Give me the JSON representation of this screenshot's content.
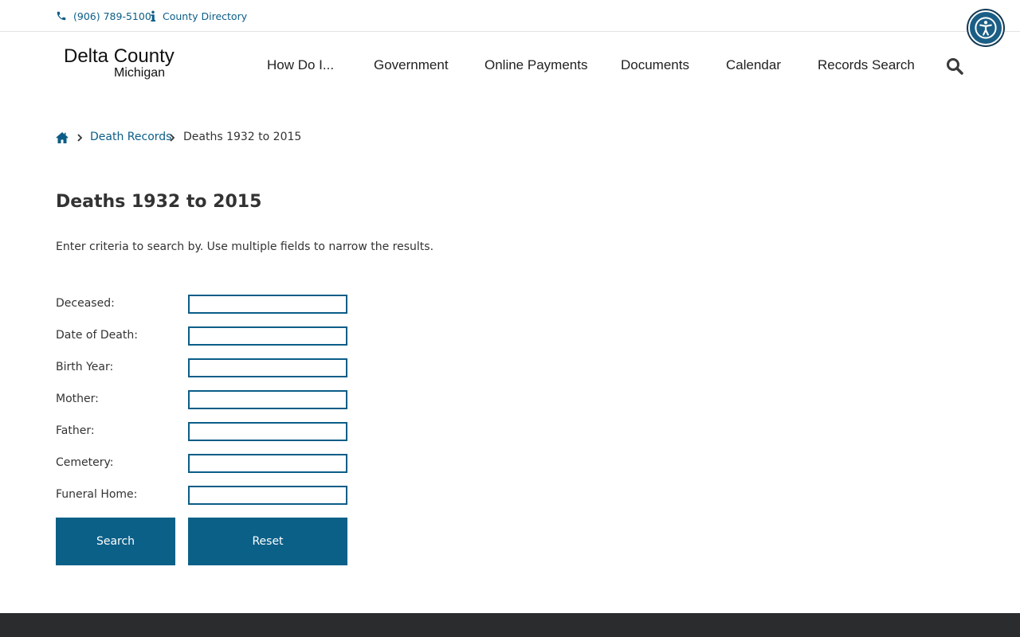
{
  "utility": {
    "phone_icon": "phone-icon",
    "phone": "(906) 789-5100",
    "info_icon": "info-icon",
    "directory": "County Directory"
  },
  "accessibility": {
    "icon": "accessibility-icon"
  },
  "logo": {
    "line1": "Delta County",
    "line2": "Michigan"
  },
  "nav": {
    "items": [
      "How Do I...",
      "Government",
      "Online Payments",
      "Documents",
      "Calendar",
      "Records Search"
    ],
    "search_icon": "search-icon"
  },
  "breadcrumb": {
    "home_icon": "home-icon",
    "items": [
      "Death Records",
      "Deaths 1932 to 2015"
    ]
  },
  "page": {
    "title": "Deaths 1932 to 2015",
    "intro": "Enter criteria to search by. Use multiple fields to narrow the results."
  },
  "form": {
    "fields": [
      {
        "label": "Deceased:",
        "value": ""
      },
      {
        "label": "Date of Death:",
        "value": ""
      },
      {
        "label": "Birth Year:",
        "value": ""
      },
      {
        "label": "Mother:",
        "value": ""
      },
      {
        "label": "Father:",
        "value": ""
      },
      {
        "label": "Cemetery:",
        "value": ""
      },
      {
        "label": "Funeral Home:",
        "value": ""
      }
    ],
    "search_label": "Search",
    "reset_label": "Reset"
  },
  "colors": {
    "link": "#0b5d87",
    "button": "#0b6088",
    "footer": "#2b2c2e",
    "accessibility": "#1a5e86"
  }
}
